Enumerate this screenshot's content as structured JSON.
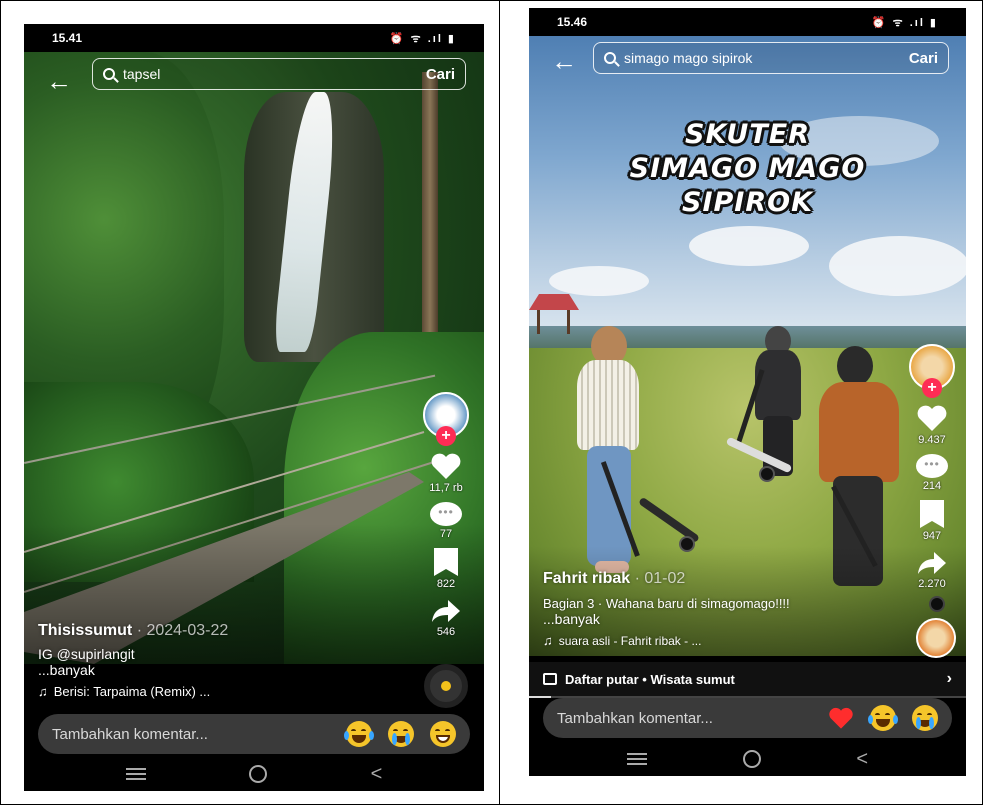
{
  "phone1": {
    "status_time": "15.41",
    "status_icons": "⏰ ᯤ .ıl ▮",
    "search_query": "tapsel",
    "search_button": "Cari",
    "likes": "11,7 rb",
    "comments": "77",
    "saves": "822",
    "shares": "546",
    "author": "Thisissumut",
    "date": "· 2024-03-22",
    "description": "IG @supirlangit",
    "more": "...banyak",
    "music": "Berisi: Tarpaima (Remix) ...",
    "comment_placeholder": "Tambahkan komentar...",
    "avatar_color": "#4a78a8"
  },
  "phone2": {
    "status_time": "15.46",
    "status_icons": "⏰ ᯤ .ıl ▮",
    "search_query": "simago mago sipirok",
    "search_button": "Cari",
    "title_line1": "SKUTER",
    "title_line2": "SIMAGO MAGO",
    "title_line3": "SIPIROK",
    "likes": "9.437",
    "comments": "214",
    "saves": "947",
    "shares": "2.270",
    "author": "Fahrit ribak",
    "date": "· 01-02",
    "description": "Bagian 3 · Wahana baru di simagomago!!!!",
    "more": "...banyak",
    "music": "suara asli - Fahrit ribak - ...",
    "playlist": "Daftar putar • Wisata sumut",
    "comment_placeholder": "Tambahkan komentar...",
    "avatar_color": "#e8a23a"
  },
  "colors": {
    "follow": "#fe2c55",
    "heart_emoji": "#ff2d2d"
  }
}
